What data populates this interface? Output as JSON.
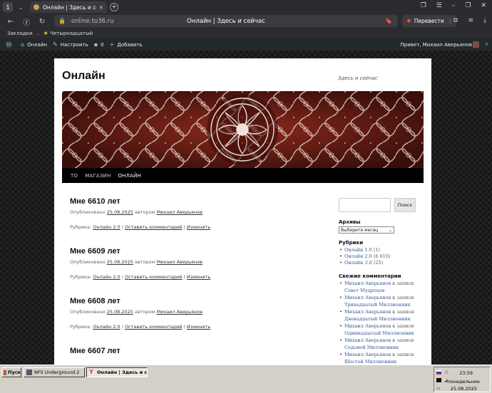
{
  "browser": {
    "tab_count_badge": "1",
    "tab_title": "Онлайн | Здесь и сейча",
    "url_host": "online.to36.ru",
    "page_title": "Онлайн | Здесь и сейчас",
    "translate_label": "Перевести"
  },
  "bookmarks": {
    "label": "Закладки",
    "items": [
      "Четырнадцатый"
    ]
  },
  "wpadmin": {
    "site": "Онлайн",
    "customize": "Настроить",
    "comments_count": "0",
    "add": "Добавить",
    "greeting": "Привет, Михаил Аверьянов"
  },
  "site": {
    "title": "Онлайн",
    "description": "Здесь и сейчас",
    "nav": [
      "ТО",
      "МАГАЗИН",
      "ОНЛАЙН"
    ],
    "nav_current": 2
  },
  "posts": [
    {
      "title": "Мне 6610 лет",
      "published": "Опубликовано",
      "date": "25.08.2025",
      "by": "автором",
      "author": "Михаил Аверьянов",
      "rubric_label": "Рубрика:",
      "category": "Онлайн 2.0",
      "comment_link": "Оставить комментарий",
      "edit": "Изменить"
    },
    {
      "title": "Мне 6609 лет",
      "published": "Опубликовано",
      "date": "25.08.2025",
      "by": "автором",
      "author": "Михаил Аверьянов",
      "rubric_label": "Рубрика:",
      "category": "Онлайн 2.0",
      "comment_link": "Оставить комментарий",
      "edit": "Изменить"
    },
    {
      "title": "Мне 6608 лет",
      "published": "Опубликовано",
      "date": "25.08.2025",
      "by": "автором",
      "author": "Михаил Аверьянов",
      "rubric_label": "Рубрика:",
      "category": "Онлайн 2.0",
      "comment_link": "Оставить комментарий",
      "edit": "Изменить"
    },
    {
      "title": "Мне 6607 лет"
    }
  ],
  "sidebar": {
    "search_button": "Поиск",
    "archives_title": "Архивы",
    "archives_select": "Выберите месяц",
    "rubrics_title": "Рубрики",
    "rubrics": [
      {
        "name": "Онлайн 1.0",
        "count": "(1)"
      },
      {
        "name": "Онлайн 2.0",
        "count": "(6 610)"
      },
      {
        "name": "Онлайн 3.0",
        "count": "(25)"
      }
    ],
    "comments_title": "Свежие комментарии",
    "comments": [
      {
        "author": "Михаил Аверьянов",
        "k": "к записи",
        "post": "Совет Мудрецов"
      },
      {
        "author": "Михаил Аверьянов",
        "k": "к записи",
        "post": "Тринадцатый Миллионник"
      },
      {
        "author": "Михаил Аверьянов",
        "k": "к записи",
        "post": "Двенадцатый Миллионник"
      },
      {
        "author": "Михаил Аверьянов",
        "k": "к записи",
        "post": "Одиннадцатый Миллионник"
      },
      {
        "author": "Михаил Аверьянов",
        "k": "к записи",
        "post": "Седьмой Миллионник"
      },
      {
        "author": "Михаил Аверьянов",
        "k": "к записи",
        "post": "Шестой Миллионник"
      }
    ]
  },
  "taskbar": {
    "start": "Пуск",
    "tasks": [
      "NFS Underground 2",
      "Онлайн | Здесь и сей..."
    ],
    "time": "23:59",
    "day": "понедельник",
    "date": "25.08.2025"
  }
}
